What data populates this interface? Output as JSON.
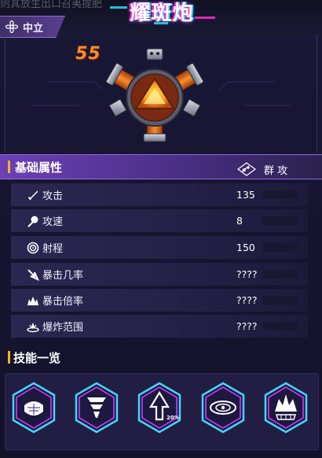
{
  "header": {
    "obscured_text": "则其放生出口召夷提肥",
    "faction_label": "中立",
    "faction_icon": "flower-icon",
    "title": "耀斑炮"
  },
  "unit": {
    "level": "55",
    "image": "turret-cannon-image"
  },
  "attributes": {
    "section_label": "基础属性",
    "attack_type": {
      "label": "群 攻",
      "icon": "group-attack-icon"
    },
    "rows": [
      {
        "icon": "sword-icon",
        "label": "攻击",
        "value": "135"
      },
      {
        "icon": "speed-icon",
        "label": "攻速",
        "value": "8"
      },
      {
        "icon": "range-target-icon",
        "label": "射程",
        "value": "150"
      },
      {
        "icon": "crit-chance-icon",
        "label": "暴击几率",
        "value": "????"
      },
      {
        "icon": "crit-multiplier-icon",
        "label": "暴击倍率",
        "value": "????"
      },
      {
        "icon": "explosion-radius-icon",
        "label": "爆炸范围",
        "value": "????"
      }
    ]
  },
  "skills": {
    "section_label": "技能一览",
    "items": [
      {
        "icon": "shield-grid-skill-icon"
      },
      {
        "icon": "tornado-skill-icon"
      },
      {
        "icon": "boost-arrow-skill-icon",
        "badge": "20%"
      },
      {
        "icon": "eye-vortex-skill-icon"
      },
      {
        "icon": "crown-burst-skill-icon"
      }
    ]
  },
  "colors": {
    "accent_orange": "#ffb11e",
    "level_orange": "#ff8a2a",
    "section_purple": "#6c40b6",
    "hex_cyan": "#3fd6ff",
    "hex_magenta": "#e23cff"
  }
}
